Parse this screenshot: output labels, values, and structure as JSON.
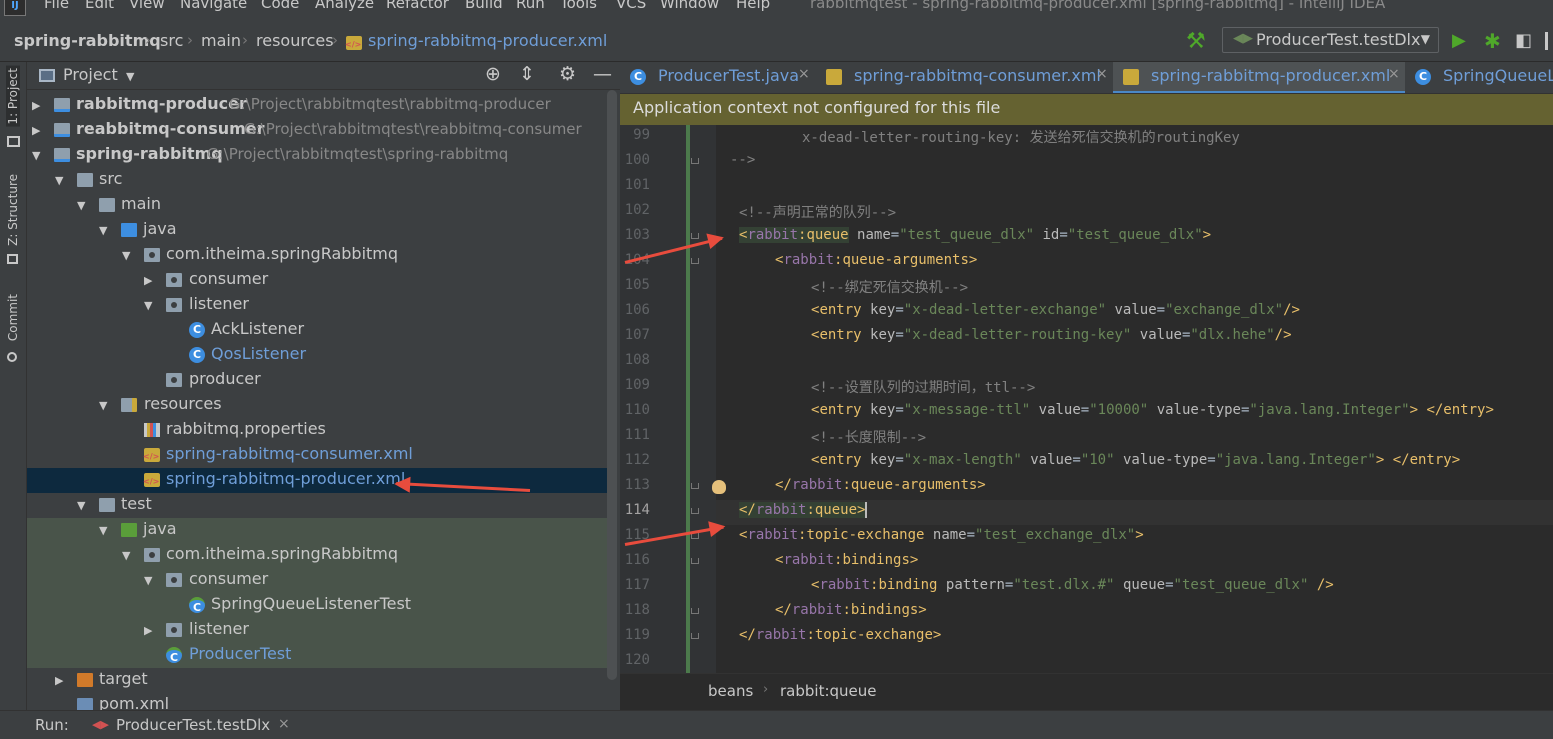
{
  "app": {
    "logo": "IJ",
    "window_title": "rabbitmqtest - spring-rabbitmq-producer.xml [spring-rabbitmq] - IntelliJ IDEA",
    "menu": [
      "File",
      "Edit",
      "View",
      "Navigate",
      "Code",
      "Analyze",
      "Refactor",
      "Build",
      "Run",
      "Tools",
      "VCS",
      "Window",
      "Help"
    ]
  },
  "breadcrumb": [
    "spring-rabbitmq",
    "src",
    "main",
    "resources",
    "spring-rabbitmq-producer.xml"
  ],
  "run_config": {
    "label": "ProducerTest.testDlx"
  },
  "side_tabs": [
    "1: Project",
    "Z: Structure",
    "Commit"
  ],
  "project_panel": {
    "title": "Project",
    "tree": [
      {
        "label": "rabbitmq-producer",
        "path": "G:\\Project\\rabbitmqtest\\rabbitmq-producer"
      },
      {
        "label": "reabbitmq-consumer",
        "path": "G:\\Project\\rabbitmqtest\\reabbitmq-consumer"
      },
      {
        "label": "spring-rabbitmq",
        "path": "G:\\Project\\rabbitmqtest\\spring-rabbitmq"
      },
      {
        "label": "src"
      },
      {
        "label": "main"
      },
      {
        "label": "java"
      },
      {
        "label": "com.itheima.springRabbitmq"
      },
      {
        "label": "consumer"
      },
      {
        "label": "listener"
      },
      {
        "label": "AckListener"
      },
      {
        "label": "QosListener"
      },
      {
        "label": "producer"
      },
      {
        "label": "resources"
      },
      {
        "label": "rabbitmq.properties"
      },
      {
        "label": "spring-rabbitmq-consumer.xml"
      },
      {
        "label": "spring-rabbitmq-producer.xml"
      },
      {
        "label": "test"
      },
      {
        "label": "java"
      },
      {
        "label": "com.itheima.springRabbitmq"
      },
      {
        "label": "consumer"
      },
      {
        "label": "SpringQueueListenerTest"
      },
      {
        "label": "listener"
      },
      {
        "label": "ProducerTest"
      },
      {
        "label": "target"
      },
      {
        "label": "pom.xml"
      }
    ]
  },
  "editor_tabs": [
    {
      "label": "ProducerTest.java",
      "icon": "class-icon"
    },
    {
      "label": "spring-rabbitmq-consumer.xml",
      "icon": "xml-icon"
    },
    {
      "label": "spring-rabbitmq-producer.xml",
      "icon": "xml-icon",
      "active": true
    },
    {
      "label": "SpringQueueLis",
      "icon": "class-icon"
    }
  ],
  "banner": "Application context not configured for this file",
  "code": {
    "line_numbers": [
      "99",
      "100",
      "101",
      "102",
      "103",
      "104",
      "105",
      "106",
      "107",
      "108",
      "109",
      "110",
      "111",
      "112",
      "113",
      "114",
      "115",
      "116",
      "117",
      "118",
      "119",
      "120"
    ],
    "current_line": "114",
    "lines": {
      "l99": "x-dead-letter-routing-key: 发送给死信交换机的routingKey",
      "l100": "-->",
      "l102": "<!--声明正常的队列-->",
      "l103": {
        "ns": "rabbit",
        "tag": ":queue",
        "attr1": "name",
        "val1": "\"test_queue_dlx\"",
        "attr2": "id",
        "val2": "\"test_queue_dlx\""
      },
      "l104": {
        "ns": "rabbit",
        "tag": ":queue-arguments"
      },
      "l105": "<!--绑定死信交换机-->",
      "l106": {
        "tag": "entry",
        "attr1": "key",
        "val1": "\"x-dead-letter-exchange\"",
        "attr2": "value",
        "val2": "\"exchange_dlx\""
      },
      "l107": {
        "tag": "entry",
        "attr1": "key",
        "val1": "\"x-dead-letter-routing-key\"",
        "attr2": "value",
        "val2": "\"dlx.hehe\""
      },
      "l109": "<!--设置队列的过期时间，ttl-->",
      "l110": {
        "tag": "entry",
        "attr1": "key",
        "val1": "\"x-message-ttl\"",
        "attr2": "value",
        "val2": "\"10000\"",
        "attr3": "value-type",
        "val3": "\"java.lang.Integer\"",
        "close": "</entry>"
      },
      "l111": "<!--长度限制-->",
      "l112": {
        "tag": "entry",
        "attr1": "key",
        "val1": "\"x-max-length\"",
        "attr2": "value",
        "val2": "\"10\"",
        "attr3": "value-type",
        "val3": "\"java.lang.Integer\"",
        "close": "</entry>"
      },
      "l113": {
        "ns": "rabbit",
        "tag": ":queue-arguments"
      },
      "l114": {
        "ns": "rabbit",
        "tag": ":queue"
      },
      "l115": {
        "ns": "rabbit",
        "tag": ":topic-exchange",
        "attr1": "name",
        "val1": "\"test_exchange_dlx\""
      },
      "l116": {
        "ns": "rabbit",
        "tag": ":bindings"
      },
      "l117": {
        "ns": "rabbit",
        "tag": ":binding",
        "attr1": "pattern",
        "val1": "\"test.dlx.#\"",
        "attr2": "queue",
        "val2": "\"test_queue_dlx\""
      },
      "l118": {
        "ns": "rabbit",
        "tag": ":bindings"
      },
      "l119": {
        "ns": "rabbit",
        "tag": ":topic-exchange"
      }
    }
  },
  "editor_breadcrumb": [
    "beans",
    "rabbit:queue"
  ],
  "bottom": {
    "run_label": "Run:",
    "run_tab": "ProducerTest.testDlx"
  },
  "colors": {
    "accent": "#4a88c7",
    "arrow": "#e84c3d",
    "banner": "#656231"
  }
}
